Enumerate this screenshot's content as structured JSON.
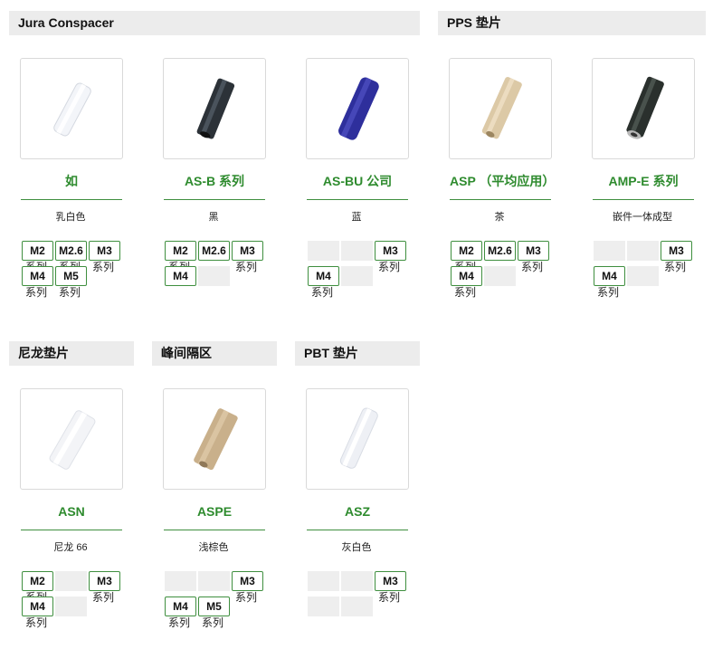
{
  "sections": {
    "jura": "Jura Conspacer",
    "pps": "PPS 垫片",
    "nylon": "尼龙垫片",
    "peak": "峰间隔区",
    "pbt": "PBT 垫片"
  },
  "products": [
    {
      "title": "如",
      "desc": "乳白色",
      "color": "#f1f3f7"
    },
    {
      "title": "AS-B 系列",
      "desc": "黑",
      "color": "#2c3238"
    },
    {
      "title": "AS-BU 公司",
      "desc": "蓝",
      "color": "#2e2f9c"
    },
    {
      "title": "ASP （平均应用）",
      "desc": "茶",
      "color": "#dcc9a6"
    },
    {
      "title": "AMP-E 系列",
      "desc": "嵌件一体成型",
      "color": "#2a302d"
    },
    {
      "title": "ASN",
      "desc": "尼龙 66",
      "color": "#f3f4f7"
    },
    {
      "title": "ASPE",
      "desc": "浅棕色",
      "color": "#c9b08b"
    },
    {
      "title": "ASZ",
      "desc": "灰白色",
      "color": "#eef0f5"
    }
  ],
  "tags": {
    "m2": "M2",
    "m26": "M2.6",
    "m3": "M3",
    "m4": "M4",
    "m5": "M5",
    "series": "系列"
  }
}
